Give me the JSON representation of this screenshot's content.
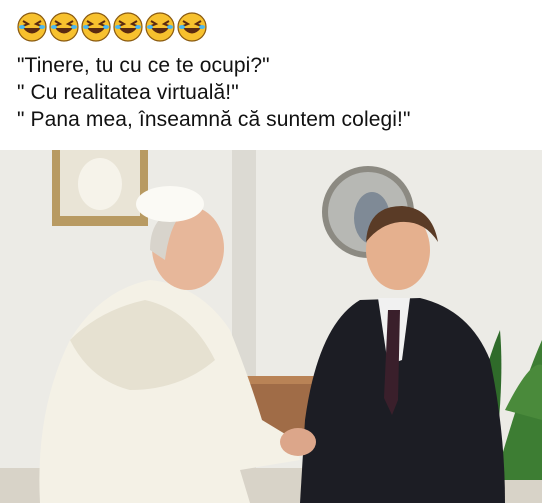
{
  "caption": {
    "emoji": [
      "laughing-face",
      "laughing-face",
      "laughing-face",
      "laughing-face",
      "laughing-face",
      "laughing-face"
    ],
    "lines": [
      "\"Tinere, tu cu ce te ocupi?\"",
      "\" Cu realitatea virtuală!\"",
      "\" Pana mea, înseamnă că suntem colegi!\""
    ]
  },
  "photo": {
    "colors": {
      "wall": "#ecebe6",
      "robe": "#f4f1e6",
      "suit": "#1c1d24",
      "tie": "#3a1f2b",
      "cabinet": "#a06c47",
      "plant": "#2f6b2a"
    }
  }
}
